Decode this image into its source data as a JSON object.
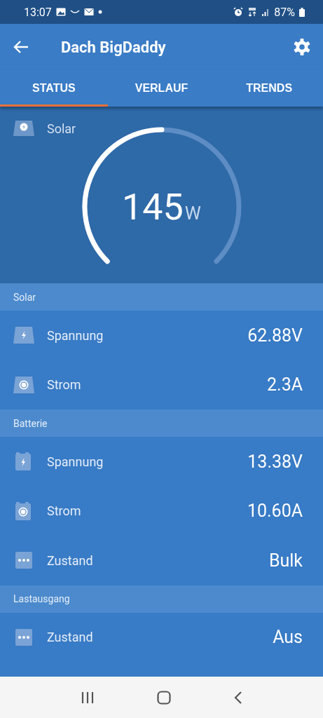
{
  "status_bar": {
    "time": "13:07",
    "battery": "87%"
  },
  "app_bar": {
    "title": "Dach BigDaddy"
  },
  "tabs": [
    {
      "label": "STATUS",
      "selected": true
    },
    {
      "label": "VERLAUF",
      "selected": false
    },
    {
      "label": "TRENDS",
      "selected": false
    }
  ],
  "gauge": {
    "label": "Solar",
    "value": "145",
    "unit": "W"
  },
  "sections": [
    {
      "title": "Solar",
      "rows": [
        {
          "kind": "panel-voltage",
          "label": "Spannung",
          "value": "62.88V"
        },
        {
          "kind": "panel-current",
          "label": "Strom",
          "value": "2.3A"
        }
      ]
    },
    {
      "title": "Batterie",
      "rows": [
        {
          "kind": "battery-voltage",
          "label": "Spannung",
          "value": "13.38V"
        },
        {
          "kind": "battery-current",
          "label": "Strom",
          "value": "10.60A"
        },
        {
          "kind": "state",
          "label": "Zustand",
          "value": "Bulk"
        }
      ]
    },
    {
      "title": "Lastausgang",
      "rows": [
        {
          "kind": "state",
          "label": "Zustand",
          "value": "Aus"
        }
      ]
    }
  ]
}
